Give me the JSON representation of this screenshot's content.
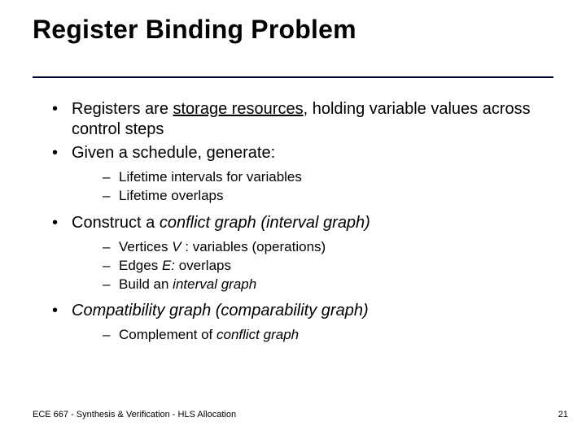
{
  "title": "Register Binding Problem",
  "bullets": {
    "b1_pre": "Registers are ",
    "b1_under": "storage resources",
    "b1_post": ", holding variable values across control steps",
    "b2": "Given a schedule, generate:",
    "b2_sub1_pre": "Lifetime intervals",
    "b2_sub1_post": " for variables",
    "b2_sub2": "Lifetime overlaps",
    "b3_pre": "Construct a ",
    "b3_ital": "conflict graph (interval graph)",
    "b3_sub1_pre": "Vertices ",
    "b3_sub1_ital": "V",
    "b3_sub1_post": " : variables (operations)",
    "b3_sub2_pre": "Edges ",
    "b3_sub2_ital": "E:",
    "b3_sub2_post": "   overlaps",
    "b3_sub3_pre": "Build an ",
    "b3_sub3_ital": "interval graph",
    "b4": "Compatibility graph  (comparability graph)",
    "b4_sub1_pre": "Complement of ",
    "b4_sub1_ital": "conflict graph"
  },
  "footer": {
    "left": "ECE 667 -  Synthesis & Verification - HLS Allocation",
    "right": "21"
  }
}
